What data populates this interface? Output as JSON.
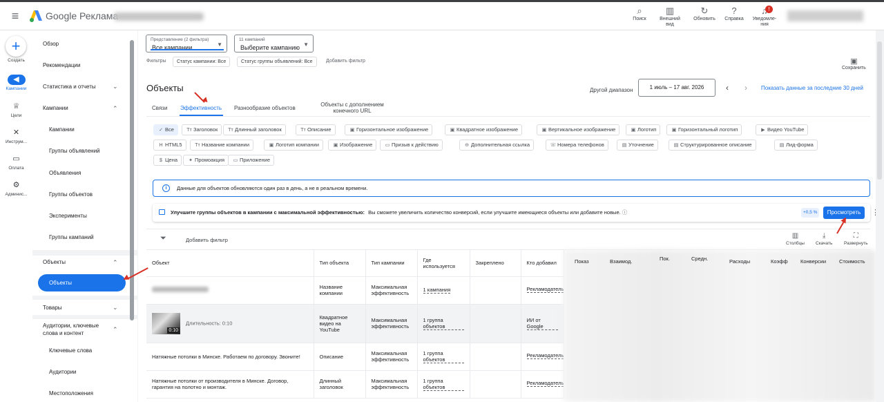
{
  "topbar": {
    "brand": "Google Реклама",
    "tools": [
      {
        "label": "Поиск",
        "icon": "search-icon"
      },
      {
        "label": "Внешний вид",
        "icon": "appearance-icon"
      },
      {
        "label": "Обновить",
        "icon": "refresh-icon"
      },
      {
        "label": "Справка",
        "icon": "help-icon"
      },
      {
        "label": "Уведомле-ния",
        "icon": "bell-icon"
      }
    ],
    "notif_badge": "!"
  },
  "rail": [
    {
      "label": "Создать",
      "icon": "plus-icon"
    },
    {
      "label": "Кампании",
      "icon": "campaign-icon",
      "active": true
    },
    {
      "label": "Цели",
      "icon": "trophy-icon"
    },
    {
      "label": "Инструм...",
      "icon": "tools-icon"
    },
    {
      "label": "Оплата",
      "icon": "card-icon"
    },
    {
      "label": "Админис...",
      "icon": "gear-icon"
    }
  ],
  "nav": {
    "overview": "Обзор",
    "recommendations": "Рекомендации",
    "stats": "Статистика и отчеты",
    "campaigns_group": "Кампании",
    "campaigns": "Кампании",
    "ad_groups": "Группы объявлений",
    "ads": "Объявления",
    "asset_groups": "Группы объектов",
    "experiments": "Эксперименты",
    "campaign_groups": "Группы кампаний",
    "assets_group": "Объекты",
    "assets_selected": "Объекты",
    "products": "Товары",
    "audiences": "Аудитории, ключевые слова и контент",
    "keywords": "Ключевые слова",
    "audiences_sub": "Аудитории",
    "locations": "Местоположения"
  },
  "filters": {
    "view_label": "Представление (2 фильтра)",
    "view_value": "Все кампании",
    "campaign_label": "11 кампаний",
    "campaign_value": "Выберите кампанию",
    "filters_label": "Фильтры",
    "chips": [
      "Статус кампании: Все",
      "Статус группы объявлений: Все"
    ],
    "add_filter": "Добавить фильтр",
    "save": "Сохранить"
  },
  "header": {
    "title": "Объекты",
    "range_label": "Другой диапазон",
    "range_value": "1 июль – 17 авг. 2026",
    "show_last": "Показать данные за последние 30 дней"
  },
  "tabs": [
    "Связи",
    "Эффективность",
    "Разнообразие объектов",
    "Объекты с дополнением конечного URL"
  ],
  "type_chips": [
    {
      "label": "Все",
      "icon": "check-icon"
    },
    {
      "label": "Заголовок",
      "icon": "text-icon"
    },
    {
      "label": "Длинный заголовок",
      "icon": "text-icon"
    },
    {
      "label": "Описание",
      "icon": "text-icon"
    },
    {
      "label": "Горизонтальное изображение",
      "icon": "image-icon"
    },
    {
      "label": "Квадратное изображение",
      "icon": "image-icon"
    },
    {
      "label": "Вертикальное изображение",
      "icon": "image-icon"
    },
    {
      "label": "Логотип",
      "icon": "image-icon"
    },
    {
      "label": "Горизонтальный логотип",
      "icon": "image-icon"
    },
    {
      "label": "Видео YouTube",
      "icon": "video-icon"
    },
    {
      "label": "HTML5",
      "icon": "html-icon"
    },
    {
      "label": "Название компании",
      "icon": "text-icon"
    },
    {
      "label": "Логотип компании",
      "icon": "image-icon"
    },
    {
      "label": "Изображение",
      "icon": "image-icon"
    },
    {
      "label": "Призыв к действию",
      "icon": "cta-icon"
    },
    {
      "label": "Дополнительная ссылка",
      "icon": "link-icon"
    },
    {
      "label": "Номера телефонов",
      "icon": "phone-icon"
    },
    {
      "label": "Уточнение",
      "icon": "callout-icon"
    },
    {
      "label": "Структурированное описание",
      "icon": "snippet-icon"
    },
    {
      "label": "Лид-форма",
      "icon": "form-icon"
    },
    {
      "label": "Цена",
      "icon": "price-icon"
    },
    {
      "label": "Промоакция",
      "icon": "promo-icon"
    },
    {
      "label": "Приложение",
      "icon": "app-icon"
    }
  ],
  "info": "Данные для объектов обновляются один раз в день, а не в реальном времени.",
  "reco": {
    "bold": "Улучшите группы объектов в кампании с максимальной эффективностью:",
    "text": "Вы сможете увеличить количество конверсий, если улучшите имеющиеся объекты или добавите новые.",
    "pct": "+0,5 %",
    "button": "Просмотреть"
  },
  "table_toolbar": {
    "add_filter": "Добавить фильтр",
    "columns": "Столбцы",
    "download": "Скачать",
    "expand": "Развернуть"
  },
  "table": {
    "headers": [
      "Объект",
      "Тип объекта",
      "Тип кампании",
      "Где используется",
      "Закреплено",
      "Кто добавил"
    ],
    "right_headers": [
      "Показ",
      "Взаимод.",
      "Пок.",
      "Средн.",
      "Расходы",
      "Коэфф",
      "Конверсии",
      "Стоимость"
    ],
    "rows": [
      {
        "asset": "",
        "type": "Название компании",
        "campaign": "Максимальная эффективность",
        "where": "1 кампания",
        "pinned": "",
        "by": "Рекламодатель"
      },
      {
        "asset": "Длительность: 0:10",
        "duration": "0:10",
        "type": "Квадратное видео на YouTube",
        "campaign": "Максимальная эффективность",
        "where": "1 группа объектов",
        "pinned": "",
        "by": "ИИ от Google"
      },
      {
        "asset": "Натяжные потолки в Минске. Работаем по договору. Звоните!",
        "type": "Описание",
        "campaign": "Максимальная эффективность",
        "where": "1 группа объектов",
        "pinned": "",
        "by": "Рекламодатель"
      },
      {
        "asset": "Натяжные потолки от производителя в Минске. Договор, гарантия на полотно и монтаж.",
        "type": "Длинный заголовок",
        "campaign": "Максимальная эффективность",
        "where": "1 группа объектов",
        "pinned": "",
        "by": "Рекламодатель"
      }
    ]
  },
  "colors": {
    "accent": "#1a73e8",
    "annotation": "#d93025"
  }
}
